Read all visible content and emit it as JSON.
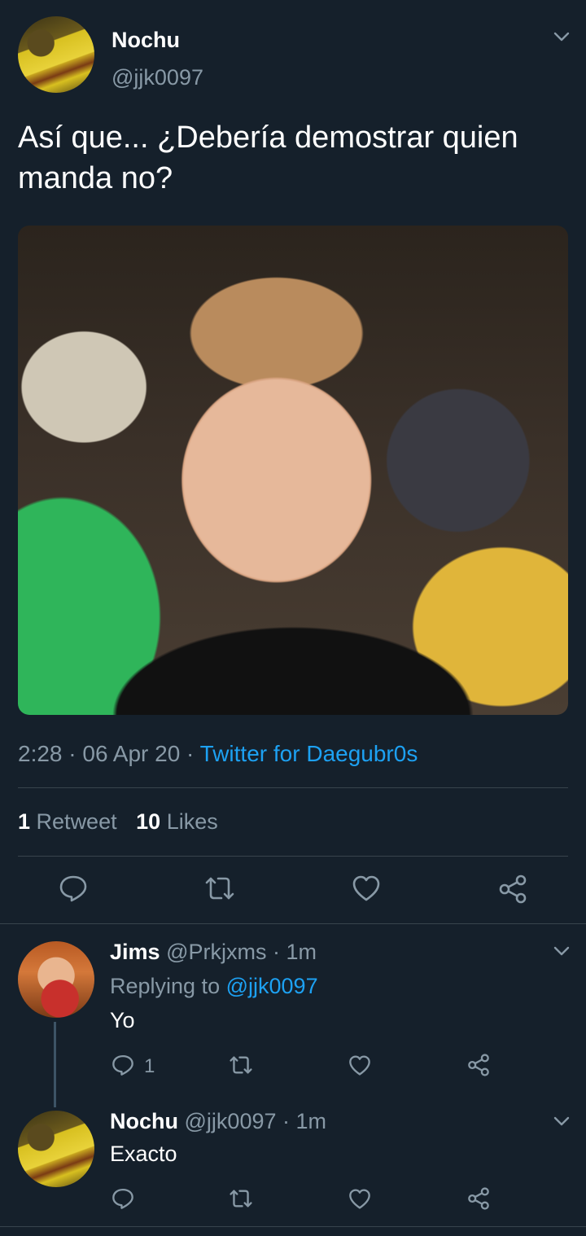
{
  "tweet": {
    "display_name": "Nochu",
    "handle": "@jjk0097",
    "text": "Así que... ¿Debería demostrar quien manda no?",
    "time": "2:28",
    "date": "06 Apr 20",
    "source": "Twitter for Daegubr0s",
    "retweets_count": "1",
    "retweets_label": "Retweet",
    "likes_count": "10",
    "likes_label": "Likes"
  },
  "replies": [
    {
      "display_name": "Jims",
      "handle": "@Prkjxms",
      "time": "1m",
      "replying_prefix": "Replying to",
      "replying_to": "@jjk0097",
      "text": "Yo",
      "reply_count": "1"
    },
    {
      "display_name": "Nochu",
      "handle": "@jjk0097",
      "time": "1m",
      "text": "Exacto"
    }
  ],
  "icons": {
    "reply": "reply-icon",
    "retweet": "retweet-icon",
    "like": "heart-icon",
    "share": "share-icon",
    "menu": "chevron-down-icon"
  },
  "colors": {
    "background": "#15202b",
    "text": "#ffffff",
    "muted": "#8899a6",
    "link": "#1da1f2",
    "divider": "#38444d"
  }
}
